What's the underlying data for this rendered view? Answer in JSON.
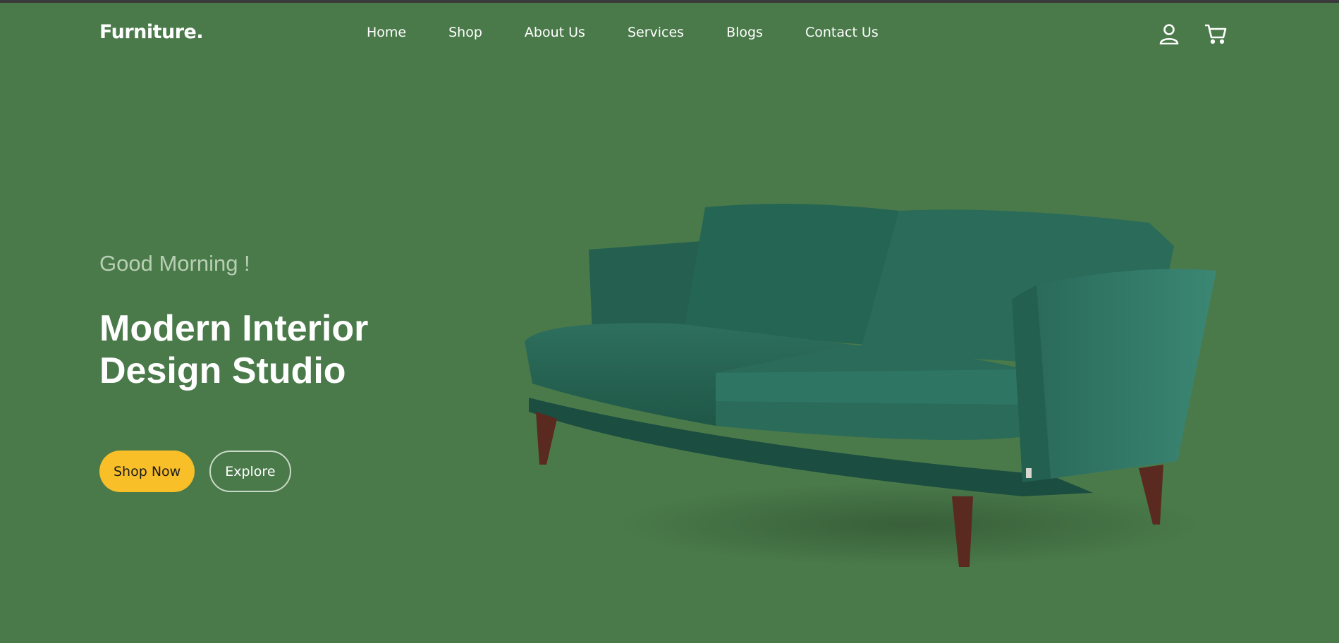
{
  "header": {
    "brand": "Furniture.",
    "menu": [
      "Home",
      "Shop",
      "About Us",
      "Services",
      "Blogs",
      "Contact Us"
    ],
    "icons": [
      "user-icon",
      "cart-icon"
    ]
  },
  "hero": {
    "greeting": "Good Morning !",
    "headline_line1": "Modern Interior",
    "headline_line2": "Design Studio",
    "primary_button": "Shop Now",
    "secondary_button": "Explore",
    "image": "green-velvet-sofa"
  },
  "colors": {
    "background": "#4a7a4a",
    "accent": "#f9bf29",
    "text": "#ffffff",
    "muted": "#b8cfb4"
  }
}
